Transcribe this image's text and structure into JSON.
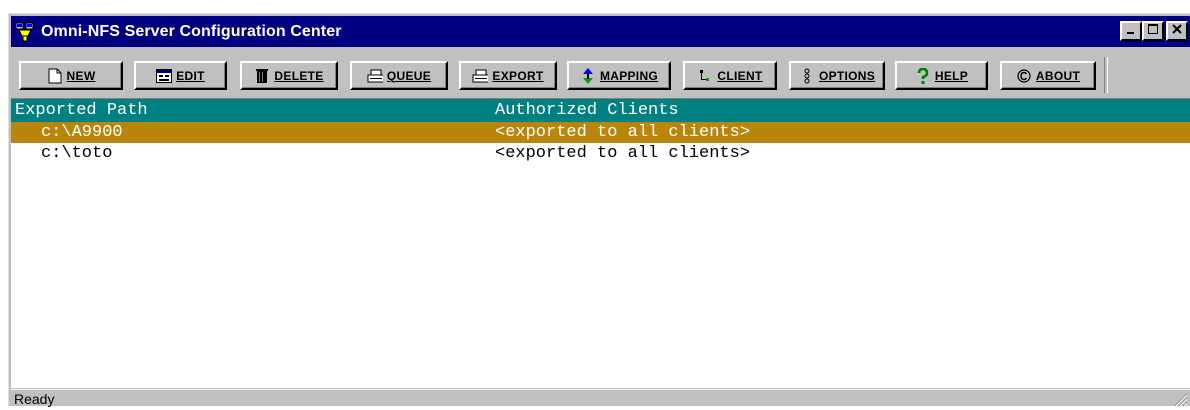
{
  "window": {
    "title": "Omni-NFS Server Configuration Center",
    "titlebar_color": "#000080"
  },
  "toolbar": {
    "buttons": [
      {
        "label": "NEW",
        "icon": "new-document-icon"
      },
      {
        "label": "EDIT",
        "icon": "edit-form-icon"
      },
      {
        "label": "DELETE",
        "icon": "trash-can-icon"
      },
      {
        "label": "QUEUE",
        "icon": "printer-queue-icon"
      },
      {
        "label": "EXPORT",
        "icon": "printer-export-icon"
      },
      {
        "label": "MAPPING",
        "icon": "up-down-arrows-icon"
      },
      {
        "label": "CLIENT",
        "icon": "network-tree-icon"
      },
      {
        "label": "OPTIONS",
        "icon": "options-dots-icon"
      },
      {
        "label": "HELP",
        "icon": "question-mark-icon"
      },
      {
        "label": "ABOUT",
        "icon": "copyright-icon"
      }
    ]
  },
  "list": {
    "columns": [
      "Exported Path",
      "Authorized Clients"
    ],
    "header_color": "#008080",
    "selected_color": "#b8860b",
    "rows": [
      {
        "path": "c:\\A9900",
        "clients": "<exported to all clients>",
        "selected": true
      },
      {
        "path": "c:\\toto",
        "clients": "<exported to all clients>",
        "selected": false
      }
    ]
  },
  "status": {
    "text": "Ready"
  }
}
